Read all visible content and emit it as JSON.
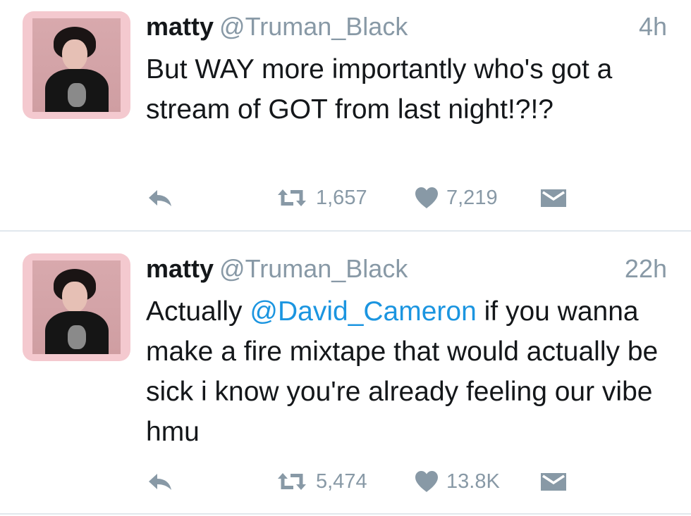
{
  "tweets": [
    {
      "name": "matty",
      "handle": "@Truman_Black",
      "time": "4h",
      "text_before": "But WAY more importantly who's got a stream of GOT from last night!?!?",
      "mention": "",
      "text_after": "",
      "retweets": "1,657",
      "likes": "7,219"
    },
    {
      "name": "matty",
      "handle": "@Truman_Black",
      "time": "22h",
      "text_before": "Actually ",
      "mention": "@David_Cameron",
      "text_after": " if you wanna make a fire mixtape that would actually be sick i know you're already feeling our vibe hmu",
      "retweets": "5,474",
      "likes": "13.8K"
    }
  ],
  "icons": {
    "reply": "reply-icon",
    "retweet": "retweet-icon",
    "like": "heart-icon",
    "dm": "envelope-icon"
  },
  "colors": {
    "text": "#14171a",
    "secondary": "#8899a6",
    "link": "#1b95e0",
    "avatar_frame": "#f4c9cf",
    "divider": "#e1e8ed"
  }
}
